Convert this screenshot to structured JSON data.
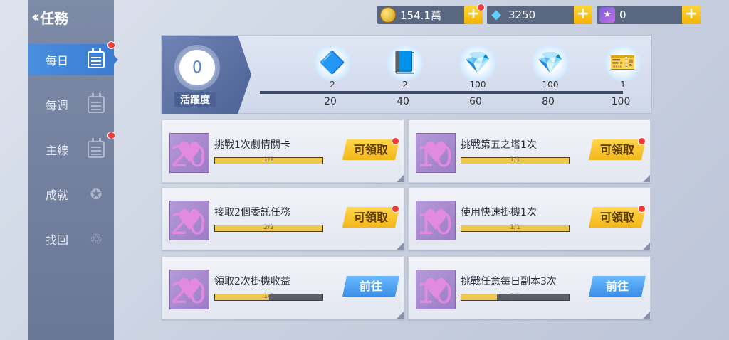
{
  "header": {
    "title": "任務"
  },
  "sidebar": {
    "items": [
      {
        "label": "每日",
        "icon": "calendar-icon",
        "active": true,
        "badge": true
      },
      {
        "label": "每週",
        "icon": "calendar-icon",
        "active": false,
        "badge": false
      },
      {
        "label": "主線",
        "icon": "calendar-icon",
        "active": false,
        "badge": true
      },
      {
        "label": "成就",
        "icon": "wreath-star-icon",
        "active": false,
        "badge": false
      },
      {
        "label": "找回",
        "icon": "hand-recover-icon",
        "active": false,
        "badge": false
      }
    ]
  },
  "currencies": [
    {
      "value": "154.1萬",
      "icon": "gold-coin-icon"
    },
    {
      "value": "3250",
      "icon": "diamond-icon"
    },
    {
      "value": "0",
      "icon": "star-gem-icon"
    }
  ],
  "activity": {
    "value": "0",
    "label": "活躍度",
    "milestones": [
      {
        "mark": "20",
        "qty": "2",
        "icon": "blue-crystal-icon"
      },
      {
        "mark": "40",
        "qty": "2",
        "icon": "blue-book-icon"
      },
      {
        "mark": "60",
        "qty": "100",
        "icon": "diamond-icon"
      },
      {
        "mark": "80",
        "qty": "100",
        "icon": "diamond-icon"
      },
      {
        "mark": "100",
        "qty": "1",
        "icon": "ticket-icon"
      }
    ]
  },
  "tasks": [
    {
      "title": "挑戰1次劇情關卡",
      "progress": "1/1",
      "fraction": 1.0,
      "button": "可領取",
      "state": "claim",
      "reward": "20"
    },
    {
      "title": "挑戰第五之塔1次",
      "progress": "1/1",
      "fraction": 1.0,
      "button": "可領取",
      "state": "claim",
      "reward": "10"
    },
    {
      "title": "接取2個委託任務",
      "progress": "2/2",
      "fraction": 1.0,
      "button": "可領取",
      "state": "claim",
      "reward": "20"
    },
    {
      "title": "使用快速掛機1次",
      "progress": "1/1",
      "fraction": 1.0,
      "button": "可領取",
      "state": "claim",
      "reward": "10"
    },
    {
      "title": "領取2次掛機收益",
      "progress": "1/2",
      "fraction": 0.5,
      "button": "前往",
      "state": "go",
      "reward": "20"
    },
    {
      "title": "挑戰任意每日副本3次",
      "progress": "1/3",
      "fraction": 0.33,
      "button": "前往",
      "state": "go",
      "reward": "10"
    }
  ]
}
